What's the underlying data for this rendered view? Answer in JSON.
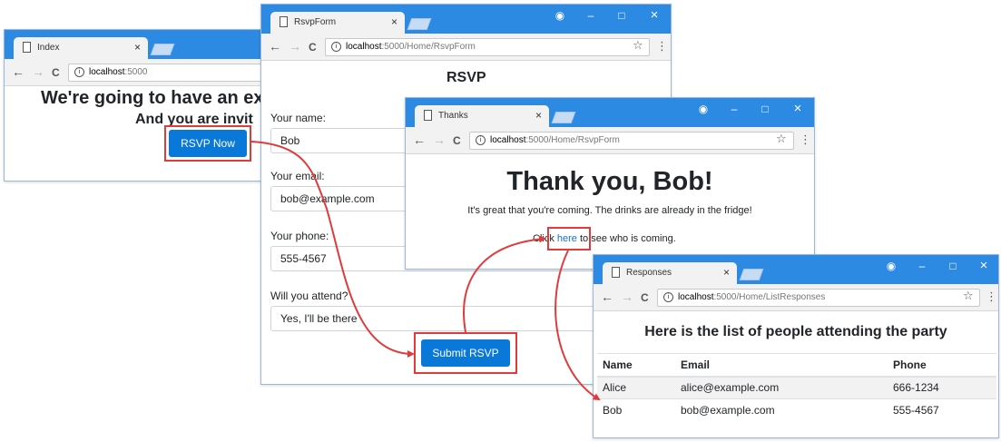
{
  "index_window": {
    "tab_title": "Index",
    "url_host": "localhost",
    "url_path": ":5000",
    "heading": "We're going to have an ex",
    "subheading": "And you are invit",
    "rsvp_button": "RSVP Now"
  },
  "rsvp_window": {
    "tab_title": "RsvpForm",
    "url_host": "localhost",
    "url_path": ":5000/Home/RsvpForm",
    "heading": "RSVP",
    "name_label": "Your name:",
    "name_value": "Bob",
    "email_label": "Your email:",
    "email_value": "bob@example.com",
    "phone_label": "Your phone:",
    "phone_value": "555-4567",
    "attend_label": "Will you attend?",
    "attend_value": "Yes, I'll be there",
    "submit_button": "Submit RSVP"
  },
  "thanks_window": {
    "tab_title": "Thanks",
    "url_host": "localhost",
    "url_path": ":5000/Home/RsvpForm",
    "heading": "Thank you, Bob!",
    "message": "It's great that you're coming. The drinks are already in the fridge!",
    "click_prefix": "Click ",
    "link_text": "here",
    "click_suffix": " to see who is coming."
  },
  "responses_window": {
    "tab_title": "Responses",
    "url_host": "localhost",
    "url_path": ":5000/Home/ListResponses",
    "heading": "Here is the list of people attending the party",
    "columns": [
      "Name",
      "Email",
      "Phone"
    ],
    "rows": [
      [
        "Alice",
        "alice@example.com",
        "666-1234"
      ],
      [
        "Bob",
        "bob@example.com",
        "555-4567"
      ]
    ]
  },
  "chrome": {
    "back_icon": "←",
    "forward_icon": "→",
    "reload_icon": "C",
    "info_icon": "i",
    "star_icon": "☆",
    "menu_icon": "⋮",
    "close_tab_icon": "×",
    "account_icon": "◉",
    "minimize_icon": "–",
    "maximize_icon": "□",
    "close_window_icon": "×"
  },
  "colors": {
    "titlebar": "#2d8ae3",
    "button": "#0a78d8",
    "highlight": "#e03a3a",
    "link": "#1a6fd1"
  }
}
